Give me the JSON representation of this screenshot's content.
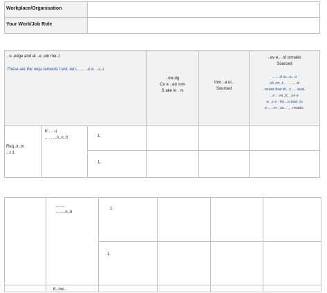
{
  "top_rows": [
    {
      "label": "Workplace/Organisation",
      "value": ""
    },
    {
      "label": "Your Work/Job Role",
      "value": ""
    }
  ],
  "table_header": {
    "requirement_title": ". o   .edge and   at   ..e ,uin me..t",
    "requirement_subtitle": "These are the requ rements I  ent, ed i...   ...  ..e      e.  ..s..t.",
    "col_knowledge": ".  ow    dg\nCo  e ..ed  rom\nS ake  lo  .  rs",
    "col_info_sourced": "Inor...a io..\nSourced",
    "col_review_title": "..ev e... of     ormatio\nSourced",
    "col_review_subtitle": "..  ...  d  re...e..  o\n.nf..rm..t..  . .  ..   ..  d-\n..nsure that th..  s . ..   eval..\n..o       ..    va..d, ..os  e\na,  .y  e   .  fro   ..o  trad.  to\no  ..  ..m  .  uo  .. .,  .rmatio."
  },
  "section1": {
    "row_label": "Req..ir..m\n...t  1",
    "sub_label": "K    .   ..   u\n...  ..  ...n..n..h",
    "items": [
      "1.",
      "1."
    ]
  },
  "section2": {
    "sub_label": "..    ....\n..  .....n..h",
    "items": [
      "1.",
      "1."
    ]
  },
  "section3": {
    "sub_label": "K..ow..."
  }
}
